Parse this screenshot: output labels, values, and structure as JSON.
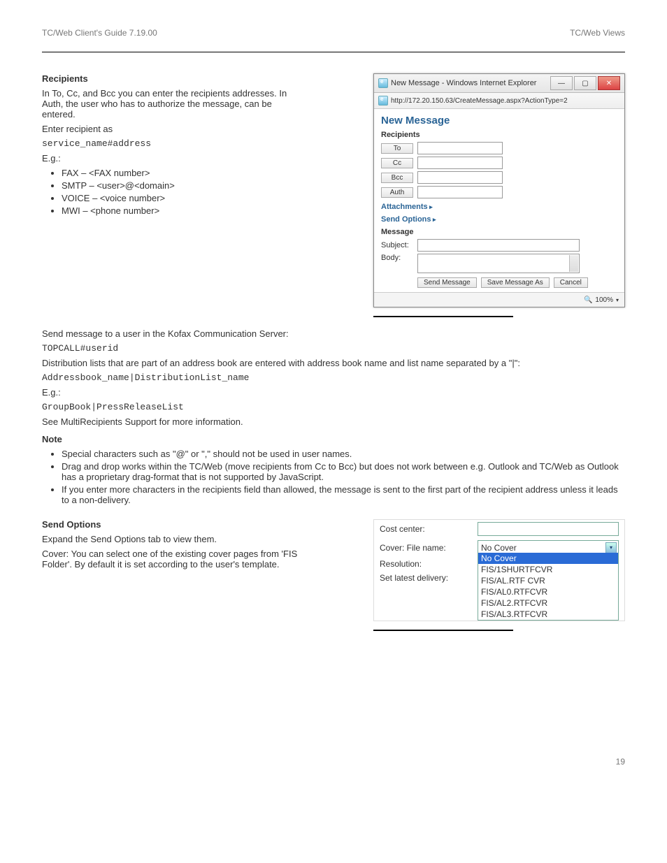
{
  "header": {
    "left": "TC/Web Client's Guide 7.19.00",
    "right": "TC/Web Views"
  },
  "rule": true,
  "left_body": {
    "section_heading": "Recipients",
    "p1": "In To, Cc, and Bcc you can enter the recipients addresses. In Auth, the user who has to authorize the message, can be entered.",
    "p2": "Enter recipient as",
    "code1": "service_name#address",
    "p3": "E.g.:",
    "bullets_services": [
      "FAX – <FAX number>",
      "SMTP – <user>@<domain>",
      "VOICE – <voice number>",
      "MWI – <phone number>"
    ],
    "p4": "Send message to a user in the Kofax Communication Server:",
    "code2": "TOPCALL#userid",
    "p5": "Distribution lists that are part of an address book are entered with address book name and list name separated by a \"|\":",
    "code3": "Addressbook_name|DistributionList_name",
    "p6": "E.g.:",
    "code4": "GroupBook|PressReleaseList",
    "p7": "See MultiRecipients Support for more information.",
    "note_heading": "Note",
    "notes": [
      "Special characters such as \"@\" or \",\" should not be used in user names.",
      "Drag and drop works within the TC/Web (move recipients from Cc to Bcc) but does not work between e.g. Outlook and TC/Web as Outlook has a proprietary drag-format that is not supported by JavaScript.",
      "If you enter more characters in the recipients field than allowed, the message is sent to the first part of the recipient address unless it leads to a non-delivery."
    ],
    "section_heading_2": "Send Options",
    "send_options_intro": "Expand the Send Options tab to view them.",
    "cover_p": "Cover: You can select one of the existing cover pages from 'FIS Folder'. By default it is set according to the user's template."
  },
  "ie_window": {
    "title": "New Message - Windows Internet Explorer",
    "url": "http://172.20.150.63/CreateMessage.aspx?ActionType=2",
    "page_heading": "New Message",
    "recipients_label": "Recipients",
    "buttons": {
      "to": "To",
      "cc": "Cc",
      "bcc": "Bcc",
      "auth": "Auth"
    },
    "attachments_label": "Attachments",
    "send_options_label": "Send Options",
    "message_label": "Message",
    "subject_label": "Subject:",
    "body_label": "Body:",
    "actions": {
      "send": "Send Message",
      "save_as": "Save Message As",
      "cancel": "Cancel"
    },
    "zoom": "100%"
  },
  "send_options_panel": {
    "cost_center": "Cost center:",
    "cover": "Cover: File name:",
    "cover_selected": "No Cover",
    "resolution": "Resolution:",
    "latest": "Set latest delivery:",
    "dropdown": [
      "No Cover",
      "FIS/1SHURTFCVR",
      "FIS/AL.RTF CVR",
      "FIS/AL0.RTFCVR",
      "FIS/AL2.RTFCVR",
      "FIS/AL3.RTFCVR"
    ],
    "dropdown_selected_index": 0
  },
  "footer": {
    "left": "",
    "right": "19"
  }
}
